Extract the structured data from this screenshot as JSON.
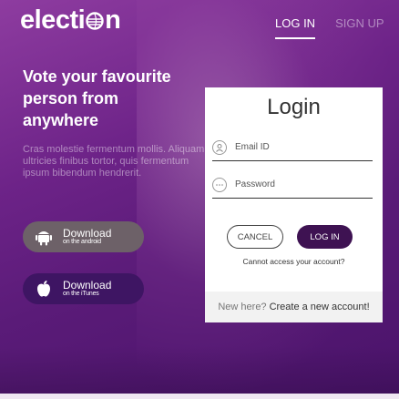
{
  "brand": {
    "logo_text_left": "electi",
    "logo_text_right": "n"
  },
  "nav": {
    "login": "LOG IN",
    "signup": "SIGN UP"
  },
  "hero": {
    "headline": "Vote your favourite person from anywhere",
    "blurb": "Cras molestie fermentum mollis. Aliquam ultricies finibus tortor, quis fermentum ipsum bibendum hendrerit."
  },
  "downloads": {
    "android": {
      "title": "Download",
      "subtitle": "on the android"
    },
    "itunes": {
      "title": "Download",
      "subtitle": "on the iTunes"
    }
  },
  "login_card": {
    "title": "Login",
    "email_placeholder": "Email ID",
    "password_placeholder": "Password",
    "cancel_label": "CANCEL",
    "login_label": "LOG IN",
    "forgot_text": "Cannot access your account?",
    "footer_prompt": "New here?",
    "footer_link": "Create a new account!"
  },
  "colors": {
    "accent": "#3e1252",
    "android_button": "#6d6168",
    "itunes_button": "#3e1563",
    "background": "#6d2388"
  },
  "icons": {
    "email": "user-icon",
    "password": "key-icon",
    "android": "android-icon",
    "itunes": "apple-icon",
    "logo": "globe-icon"
  }
}
